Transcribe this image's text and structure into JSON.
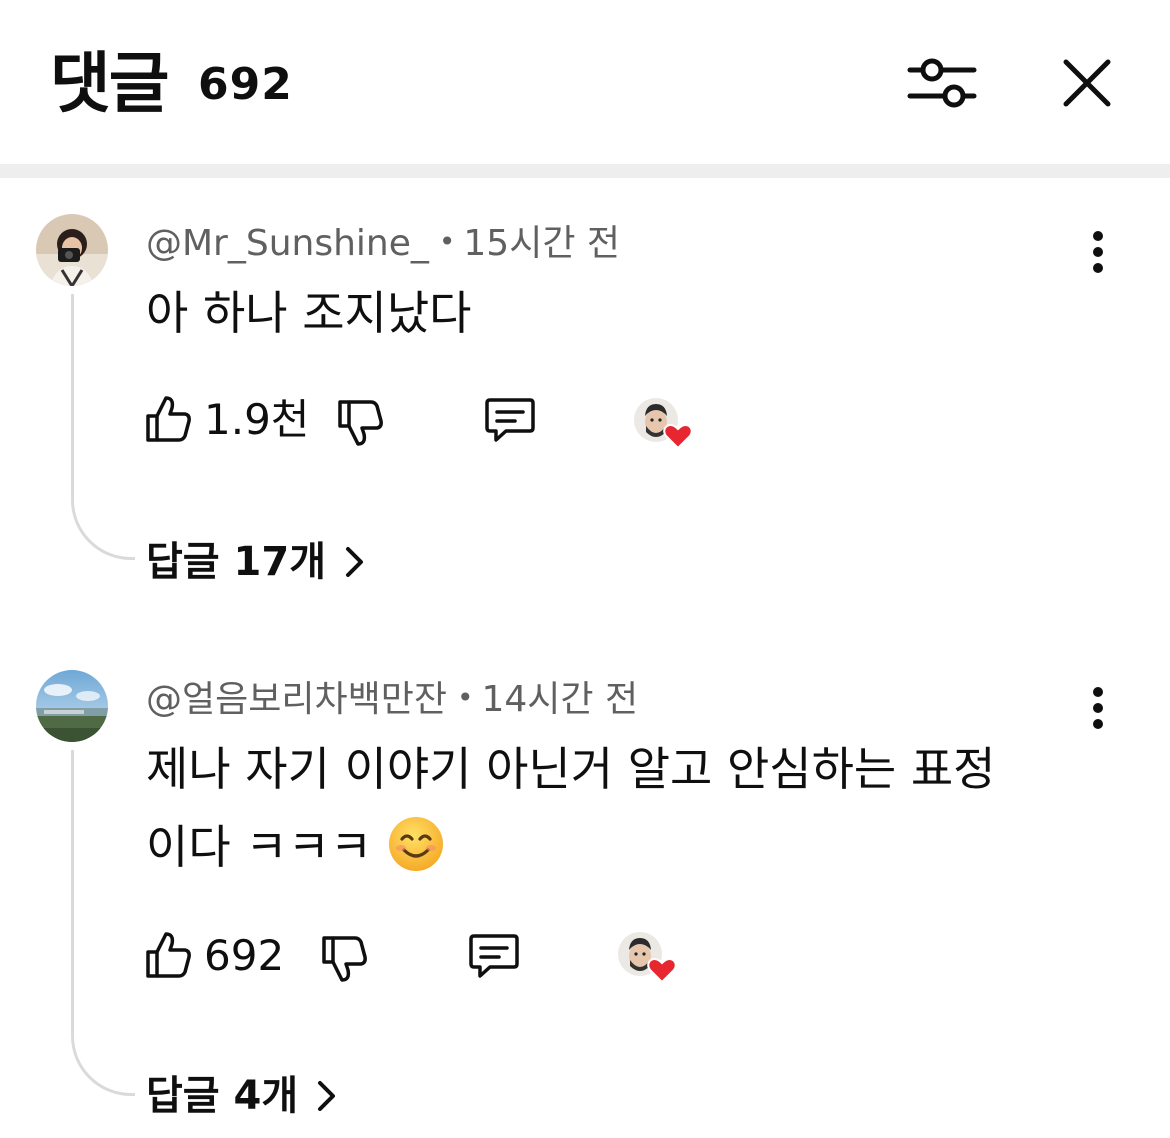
{
  "header": {
    "title": "댓글",
    "count": "692"
  },
  "comments": [
    {
      "author": "@Mr_Sunshine_",
      "separator": "•",
      "time": "15시간 전",
      "text": "아 하나 조지났다",
      "likes": "1.9천",
      "replies_label": "답글 17개"
    },
    {
      "author": "@얼음보리차백만잔",
      "separator": "•",
      "time": "14시간 전",
      "text_line1": "제나 자기 이야기 아닌거 알고 안심하는 표정",
      "text_line2": "이다 ㅋㅋㅋ",
      "likes": "692",
      "replies_label": "답글 4개"
    }
  ],
  "colors": {
    "heart": "#e8262f",
    "meta_text": "#606060",
    "divider": "#eeeeee"
  }
}
